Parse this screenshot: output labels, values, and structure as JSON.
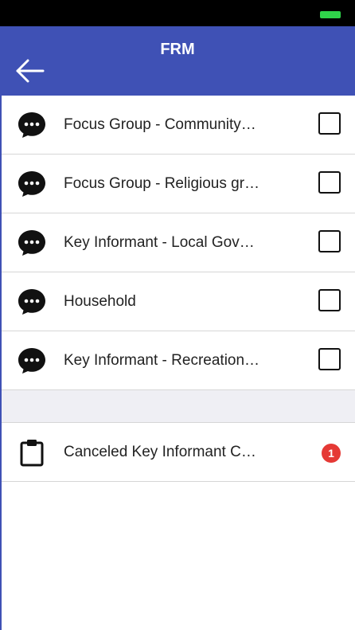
{
  "header": {
    "title": "FRM",
    "back_icon": "arrow-left-icon"
  },
  "colors": {
    "app_bar": "#3f51b5",
    "status_bar": "#000000",
    "battery": "#2fd34a",
    "badge": "#e53935"
  },
  "survey_items": [
    {
      "label": "Focus Group - Community…",
      "icon": "chat-bubble-icon",
      "checked": false
    },
    {
      "label": "Focus Group - Religious gr…",
      "icon": "chat-bubble-icon",
      "checked": false
    },
    {
      "label": "Key Informant - Local Gov…",
      "icon": "chat-bubble-icon",
      "checked": false
    },
    {
      "label": "Household",
      "icon": "chat-bubble-icon",
      "checked": false
    },
    {
      "label": "Key Informant - Recreation…",
      "icon": "chat-bubble-icon",
      "checked": false
    }
  ],
  "canceled_item": {
    "label": "Canceled Key Informant C…",
    "icon": "clipboard-icon",
    "badge": "1"
  }
}
